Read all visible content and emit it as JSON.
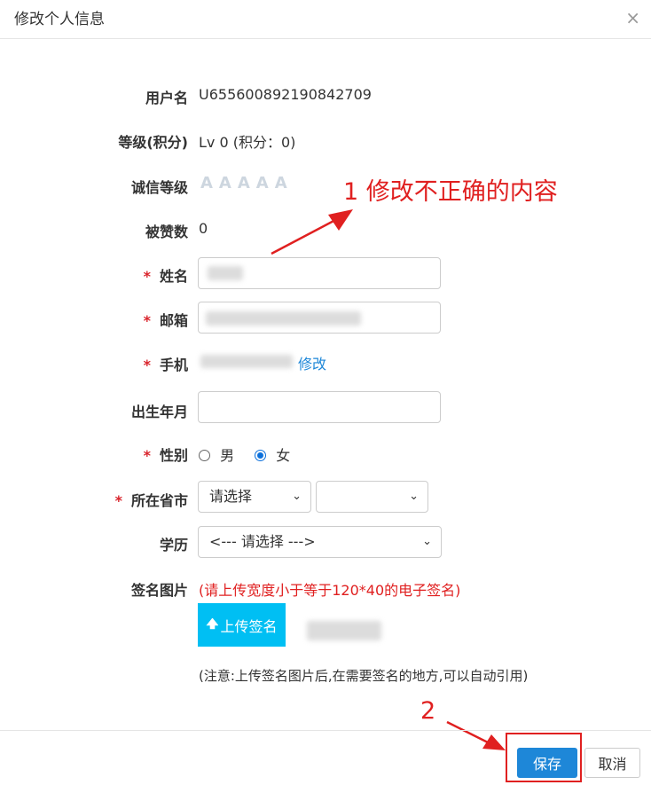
{
  "dialog": {
    "title": "修改个人信息",
    "close": "×"
  },
  "form": {
    "username": {
      "label": "用户名",
      "value": "U655600892190842709"
    },
    "level": {
      "label": "等级(积分)",
      "value": "Lv 0 (积分：0)"
    },
    "credit": {
      "label": "诚信等级",
      "stars": "AAAAA"
    },
    "likes": {
      "label": "被赞数",
      "value": "0"
    },
    "name": {
      "required": "*",
      "label": "姓名"
    },
    "email": {
      "required": "*",
      "label": "邮箱"
    },
    "phone": {
      "required": "*",
      "label": "手机",
      "edit_link": "修改"
    },
    "birthday": {
      "label": "出生年月",
      "value": ""
    },
    "gender": {
      "required": "*",
      "label": "性别",
      "options": [
        "男",
        "女"
      ],
      "selected": "女"
    },
    "city": {
      "required": "*",
      "label": "所在省市",
      "province": "请选择",
      "city": ""
    },
    "education": {
      "label": "学历",
      "value": "<--- 请选择 --->"
    },
    "signature": {
      "label": "签名图片",
      "hint": "(请上传宽度小于等于120*40的电子签名)",
      "upload_label": "上传签名",
      "note": "(注意:上传签名图片后,在需要签名的地方,可以自动引用)"
    }
  },
  "footer": {
    "save": "保存",
    "cancel": "取消"
  },
  "annotations": {
    "step1": "1 修改不正确的内容",
    "step2": "2"
  },
  "colors": {
    "required": "#d9232b",
    "link": "#1e87d8",
    "primary": "#1e87d8",
    "upload": "#00bff3",
    "annotation": "#e02020"
  }
}
